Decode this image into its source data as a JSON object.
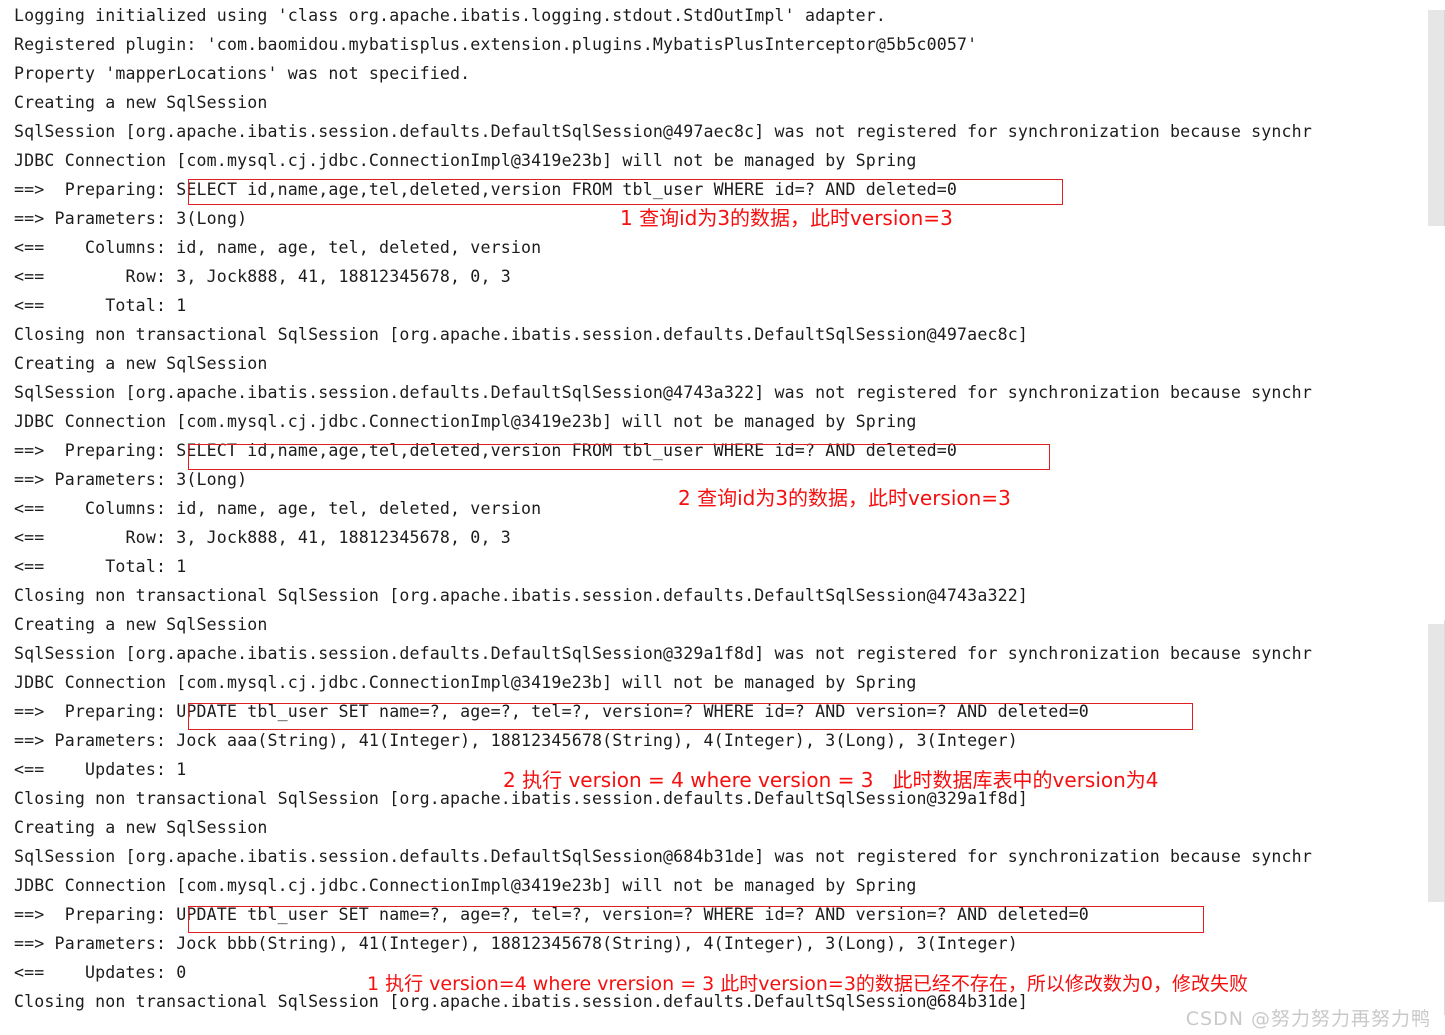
{
  "console": {
    "title": "MyBatis-Plus Console Log",
    "background_color": "#ffffff",
    "text_color": "#1c1c1c",
    "annotation_color": "#f50f0f",
    "box_color": "#e02020",
    "lines": [
      "Logging initialized using 'class org.apache.ibatis.logging.stdout.StdOutImpl' adapter.",
      "Registered plugin: 'com.baomidou.mybatisplus.extension.plugins.MybatisPlusInterceptor@5b5c0057'",
      "Property 'mapperLocations' was not specified.",
      "Creating a new SqlSession",
      "SqlSession [org.apache.ibatis.session.defaults.DefaultSqlSession@497aec8c] was not registered for synchronization because synchr",
      "JDBC Connection [com.mysql.cj.jdbc.ConnectionImpl@3419e23b] will not be managed by Spring",
      "==>  Preparing: SELECT id,name,age,tel,deleted,version FROM tbl_user WHERE id=? AND deleted=0",
      "==> Parameters: 3(Long)",
      "<==    Columns: id, name, age, tel, deleted, version",
      "<==        Row: 3, Jock888, 41, 18812345678, 0, 3",
      "<==      Total: 1",
      "Closing non transactional SqlSession [org.apache.ibatis.session.defaults.DefaultSqlSession@497aec8c]",
      "Creating a new SqlSession",
      "SqlSession [org.apache.ibatis.session.defaults.DefaultSqlSession@4743a322] was not registered for synchronization because synchr",
      "JDBC Connection [com.mysql.cj.jdbc.ConnectionImpl@3419e23b] will not be managed by Spring",
      "==>  Preparing: SELECT id,name,age,tel,deleted,version FROM tbl_user WHERE id=? AND deleted=0",
      "==> Parameters: 3(Long)",
      "<==    Columns: id, name, age, tel, deleted, version",
      "<==        Row: 3, Jock888, 41, 18812345678, 0, 3",
      "<==      Total: 1",
      "Closing non transactional SqlSession [org.apache.ibatis.session.defaults.DefaultSqlSession@4743a322]",
      "Creating a new SqlSession",
      "SqlSession [org.apache.ibatis.session.defaults.DefaultSqlSession@329a1f8d] was not registered for synchronization because synchr",
      "JDBC Connection [com.mysql.cj.jdbc.ConnectionImpl@3419e23b] will not be managed by Spring",
      "==>  Preparing: UPDATE tbl_user SET name=?, age=?, tel=?, version=? WHERE id=? AND version=? AND deleted=0",
      "==> Parameters: Jock aaa(String), 41(Integer), 18812345678(String), 4(Integer), 3(Long), 3(Integer)",
      "<==    Updates: 1",
      "Closing non transactional SqlSession [org.apache.ibatis.session.defaults.DefaultSqlSession@329a1f8d]",
      "Creating a new SqlSession",
      "SqlSession [org.apache.ibatis.session.defaults.DefaultSqlSession@684b31de] was not registered for synchronization because synchr",
      "JDBC Connection [com.mysql.cj.jdbc.ConnectionImpl@3419e23b] will not be managed by Spring",
      "==>  Preparing: UPDATE tbl_user SET name=?, age=?, tel=?, version=? WHERE id=? AND version=? AND deleted=0",
      "==> Parameters: Jock bbb(String), 41(Integer), 18812345678(String), 4(Integer), 3(Long), 3(Integer)",
      "<==    Updates: 0",
      "Closing non transactional SqlSession [org.apache.ibatis.session.defaults.DefaultSqlSession@684b31de]"
    ],
    "annotations": [
      "1 查询id为3的数据，此时version=3",
      "2 查询id为3的数据，此时version=3",
      "2 执行 version = 4 where version = 3   此时数据库表中的version为4",
      "1 执行 version=4 where vrersion = 3 此时version=3的数据已经不存在，所以修改数为0，修改失败"
    ],
    "watermark": "CSDN @努力努力再努力鸭"
  }
}
